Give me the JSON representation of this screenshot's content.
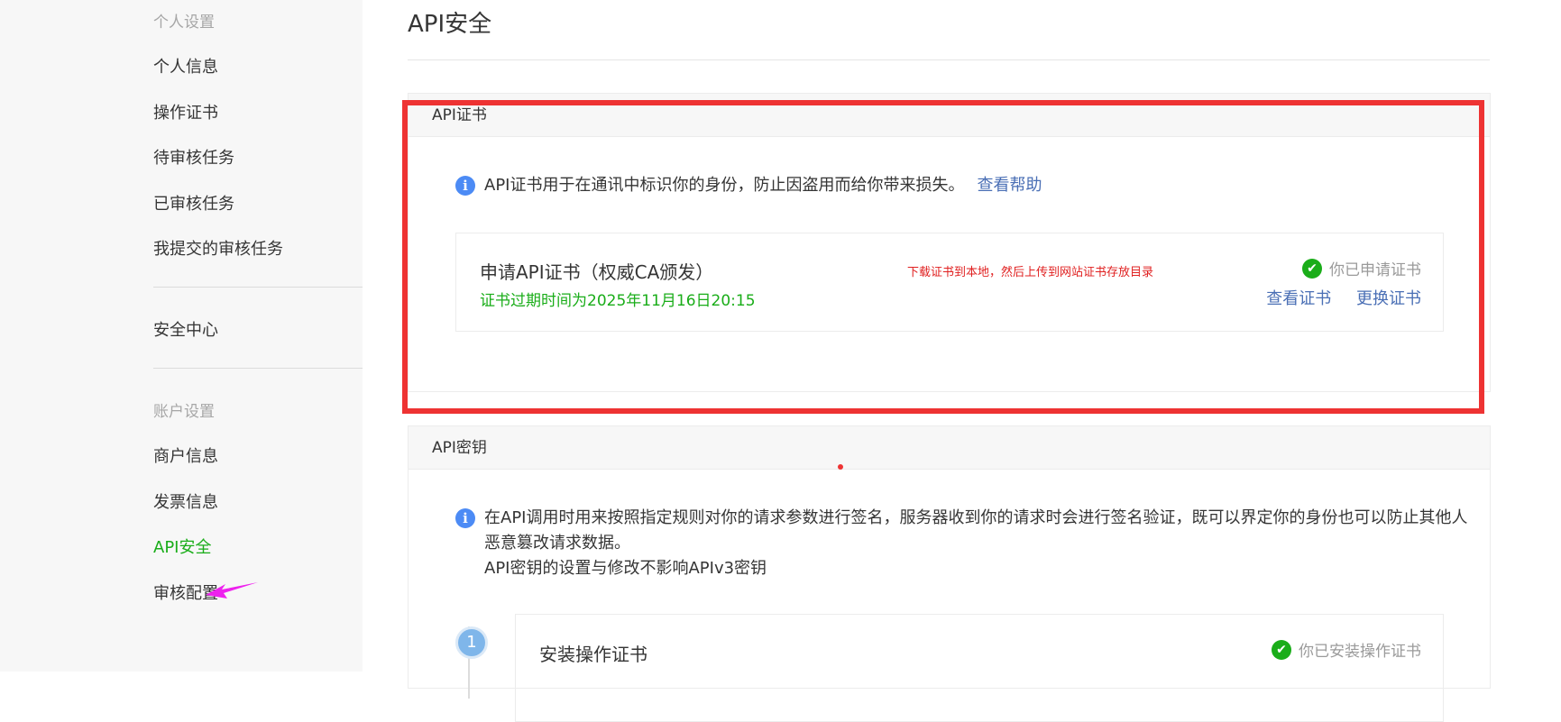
{
  "sidebar": {
    "group_personal": "个人设置",
    "items_personal": [
      "个人信息",
      "操作证书",
      "待审核任务",
      "已审核任务",
      "我提交的审核任务"
    ],
    "security_center": "安全中心",
    "group_account": "账户设置",
    "items_account": [
      "商户信息",
      "发票信息",
      "API安全",
      "审核配置"
    ],
    "active_item": "API安全",
    "active_color": "#1aad19",
    "arrow_color": "#ee22ee"
  },
  "main": {
    "page_title": "API安全",
    "cert_panel": {
      "header": "API证书",
      "info_text": "API证书用于在通讯中标识你的身份，防止因盗用而给你带来损失。",
      "help_link": "查看帮助",
      "card": {
        "title": "申请API证书（权威CA颁发）",
        "expire_text": "证书过期时间为2025年11月16日20:15",
        "note": "下载证书到本地，然后上传到网站证书存放目录",
        "status": "你已申请证书",
        "view_cert": "查看证书",
        "replace_cert": "更换证书"
      }
    },
    "key_panel": {
      "header": "API密钥",
      "info_line1": "在API调用时用来按照指定规则对你的请求参数进行签名，服务器收到你的请求时会进行签名验证，既可以界定你的身份也可以防止其他人",
      "info_line2": "恶意篡改请求数据。",
      "info_line3": "API密钥的设置与修改不影响APIv3密钥",
      "step": {
        "number": "1",
        "title": "安装操作证书",
        "status": "你已安装操作证书"
      }
    }
  },
  "colors": {
    "highlight_border": "#ee3333",
    "link": "#4a6fb5",
    "success": "#1aad19",
    "info_icon": "#4c8bf5"
  },
  "icons": {
    "info": "info-icon",
    "check": "check-circle-icon",
    "arrow": "pointer-arrow-icon"
  }
}
